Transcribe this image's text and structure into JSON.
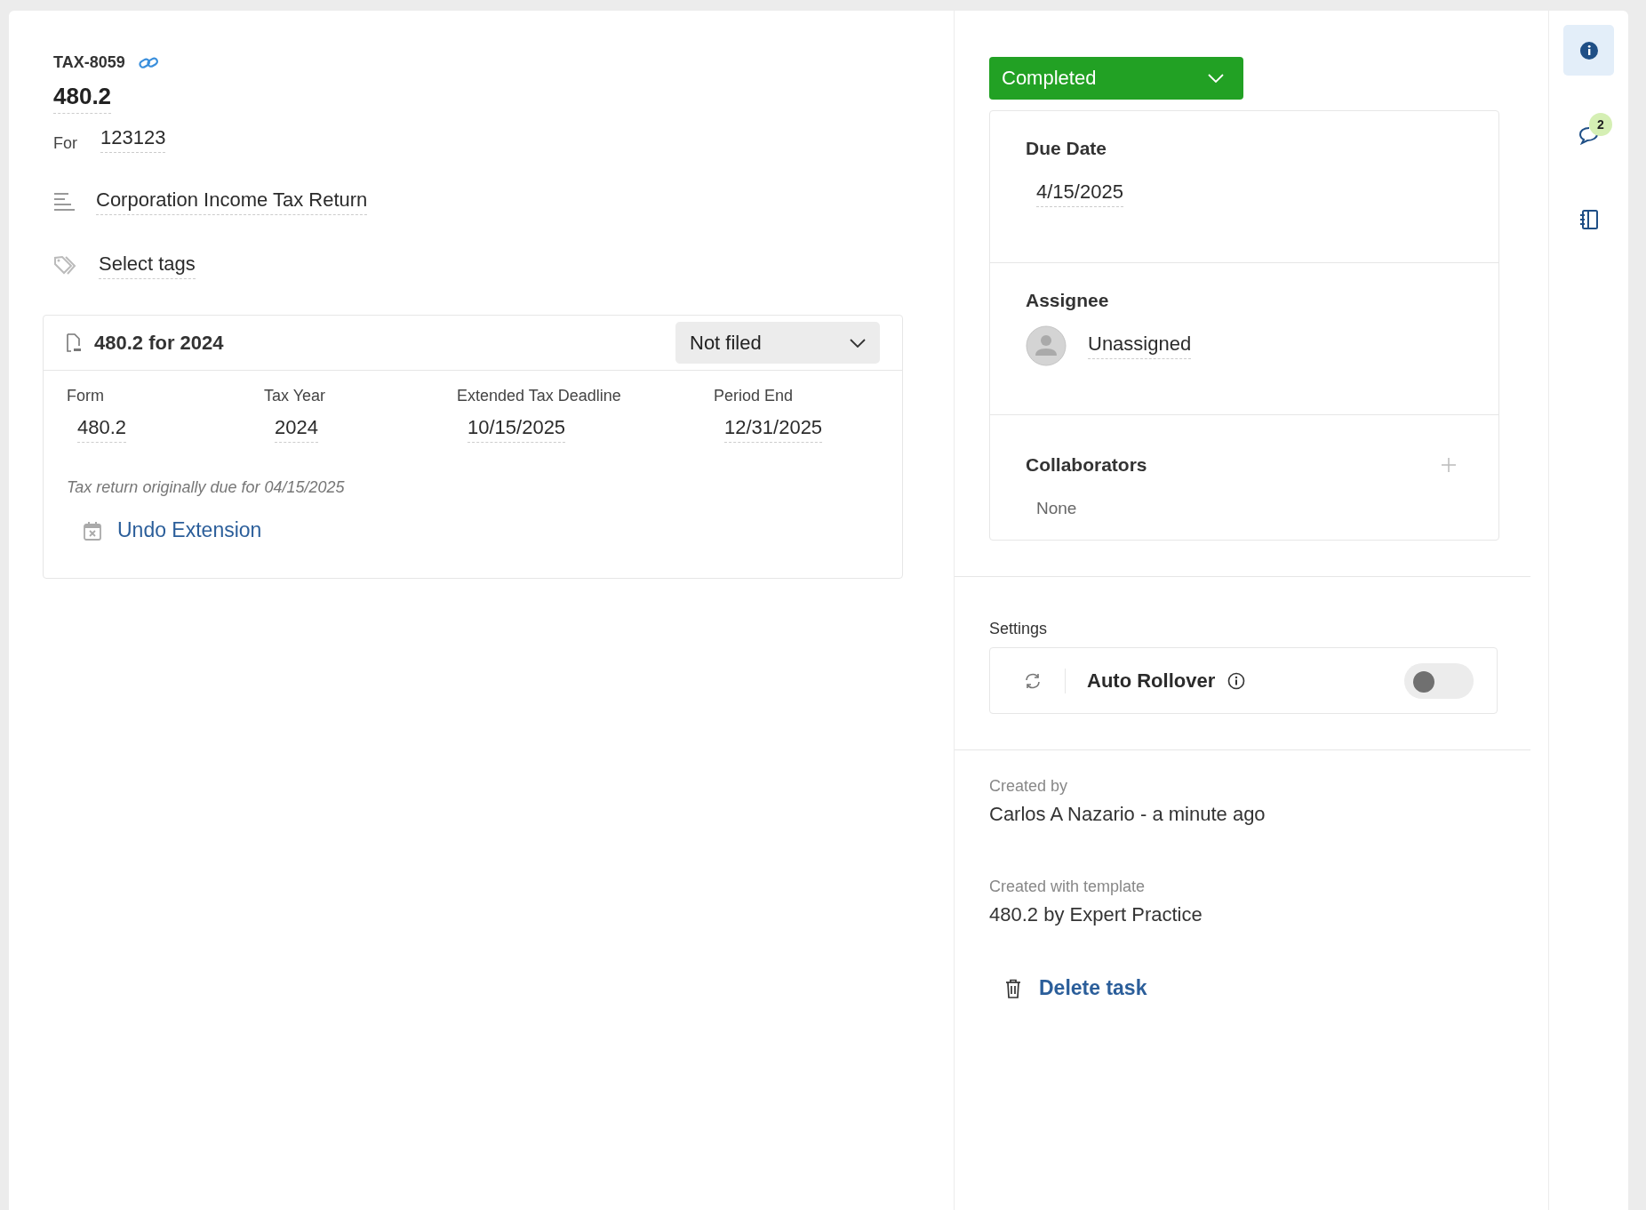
{
  "task": {
    "id": "TAX-8059",
    "title": "480.2",
    "for_label": "For",
    "for_value": "123123",
    "description": "Corporation Income Tax Return",
    "tags_placeholder": "Select tags"
  },
  "return_card": {
    "title": "480.2 for 2024",
    "filing_status": "Not filed",
    "fields": [
      {
        "label": "Form",
        "value": "480.2"
      },
      {
        "label": "Tax Year",
        "value": "2024"
      },
      {
        "label": "Extended Tax Deadline",
        "value": "10/15/2025"
      },
      {
        "label": "Period End",
        "value": "12/31/2025"
      }
    ],
    "note": "Tax return originally due for 04/15/2025",
    "action": "Undo Extension"
  },
  "status": "Completed",
  "due_date": {
    "label": "Due Date",
    "value": "4/15/2025"
  },
  "assignee": {
    "label": "Assignee",
    "value": "Unassigned"
  },
  "collaborators": {
    "label": "Collaborators",
    "value": "None"
  },
  "settings": {
    "label": "Settings",
    "items": [
      {
        "label": "Auto Rollover",
        "on": false
      }
    ]
  },
  "created_by": {
    "label": "Created by",
    "value": "Carlos A Nazario - a minute ago"
  },
  "template": {
    "label": "Created with template",
    "value": "480.2 by Expert Practice"
  },
  "delete_action": "Delete task",
  "rail": [
    {
      "kind": "info",
      "selected": true
    },
    {
      "kind": "comments",
      "badge": "2",
      "selected": false
    },
    {
      "kind": "notebook",
      "selected": false
    }
  ]
}
